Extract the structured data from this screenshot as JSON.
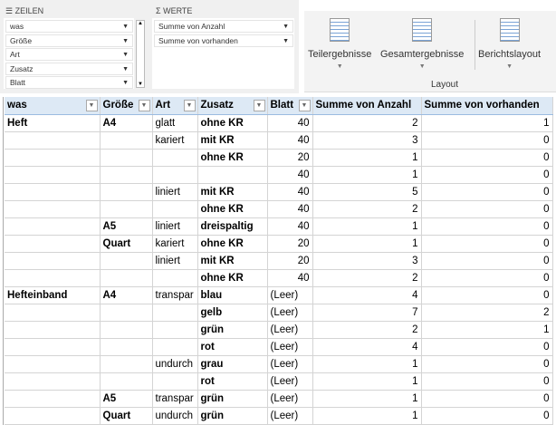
{
  "rows_pane": {
    "title": "ZEILEN",
    "fields": [
      "was",
      "Größe",
      "Art",
      "Zusatz",
      "Blatt"
    ]
  },
  "values_pane": {
    "title": "WERTE",
    "fields": [
      "Summe von Anzahl",
      "Summe von vorhanden"
    ]
  },
  "ribbon": {
    "buttons": [
      "Teilergebnisse",
      "Gesamtergebnisse",
      "Berichtslayout"
    ],
    "group": "Layout"
  },
  "table": {
    "headers": [
      "was",
      "Größe",
      "Art",
      "Zusatz",
      "Blatt",
      "Summe von Anzahl",
      "Summe von vorhanden"
    ],
    "rows": [
      [
        "Heft",
        "A4",
        "glatt",
        "ohne KR",
        "40",
        "2",
        "1"
      ],
      [
        "",
        "",
        "kariert",
        "mit KR",
        "40",
        "3",
        "0"
      ],
      [
        "",
        "",
        "",
        "ohne KR",
        "20",
        "1",
        "0"
      ],
      [
        "",
        "",
        "",
        "",
        "40",
        "1",
        "0"
      ],
      [
        "",
        "",
        "liniert",
        "mit KR",
        "40",
        "5",
        "0"
      ],
      [
        "",
        "",
        "",
        "ohne KR",
        "40",
        "2",
        "0"
      ],
      [
        "",
        "A5",
        "liniert",
        "dreispaltig",
        "40",
        "1",
        "0"
      ],
      [
        "",
        "Quart",
        "kariert",
        "ohne KR",
        "20",
        "1",
        "0"
      ],
      [
        "",
        "",
        "liniert",
        "mit KR",
        "20",
        "3",
        "0"
      ],
      [
        "",
        "",
        "",
        "ohne KR",
        "40",
        "2",
        "0"
      ],
      [
        "Hefteinband",
        "A4",
        "transpar",
        "blau",
        "(Leer)",
        "4",
        "0"
      ],
      [
        "",
        "",
        "",
        "gelb",
        "(Leer)",
        "7",
        "2"
      ],
      [
        "",
        "",
        "",
        "grün",
        "(Leer)",
        "2",
        "1"
      ],
      [
        "",
        "",
        "",
        "rot",
        "(Leer)",
        "4",
        "0"
      ],
      [
        "",
        "",
        "undurch",
        "grau",
        "(Leer)",
        "1",
        "0"
      ],
      [
        "",
        "",
        "",
        "rot",
        "(Leer)",
        "1",
        "0"
      ],
      [
        "",
        "A5",
        "transpar",
        "grün",
        "(Leer)",
        "1",
        "0"
      ],
      [
        "",
        "Quart",
        "undurch",
        "grün",
        "(Leer)",
        "1",
        "0"
      ]
    ]
  }
}
